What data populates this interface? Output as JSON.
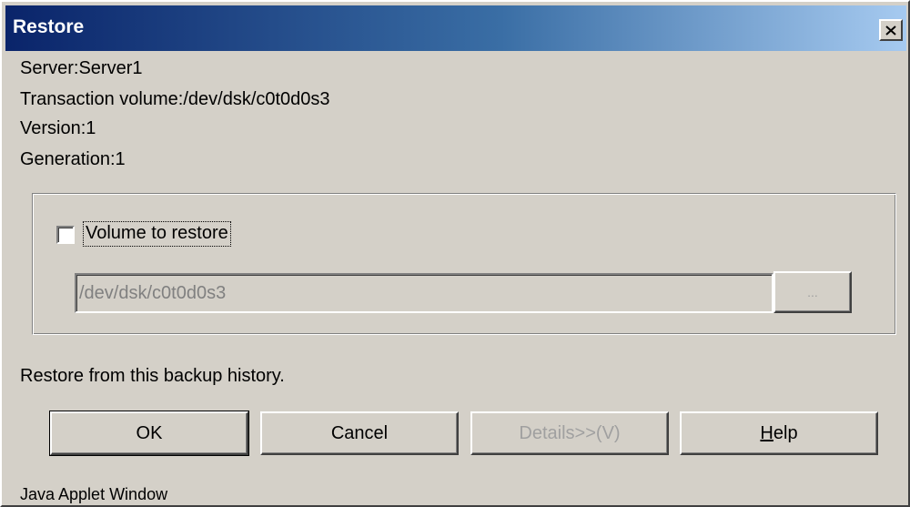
{
  "window": {
    "title": "Restore",
    "close_label": "Close"
  },
  "info": {
    "server": "Server:Server1",
    "transaction_volume": "Transaction volume:/dev/dsk/c0t0d0s3",
    "version": "Version:1",
    "generation": "Generation:1"
  },
  "volume_group": {
    "checkbox_label": "Volume to restore",
    "checkbox_checked": false,
    "volume_value": "/dev/dsk/c0t0d0s3",
    "browse_label": "..."
  },
  "message": "Restore from this backup history.",
  "buttons": {
    "ok": "OK",
    "cancel": "Cancel",
    "details": "Details>>(V)",
    "help_mnemonic": "H",
    "help_rest": "elp"
  },
  "footer": "Java Applet Window",
  "colors": {
    "window_bg": "#d4d0c8",
    "title_start": "#0a246a",
    "title_end": "#a6caf0",
    "disabled_text": "#a0a0a0"
  },
  "icons": {
    "close": "close-icon",
    "checkbox": "checkbox-icon"
  }
}
